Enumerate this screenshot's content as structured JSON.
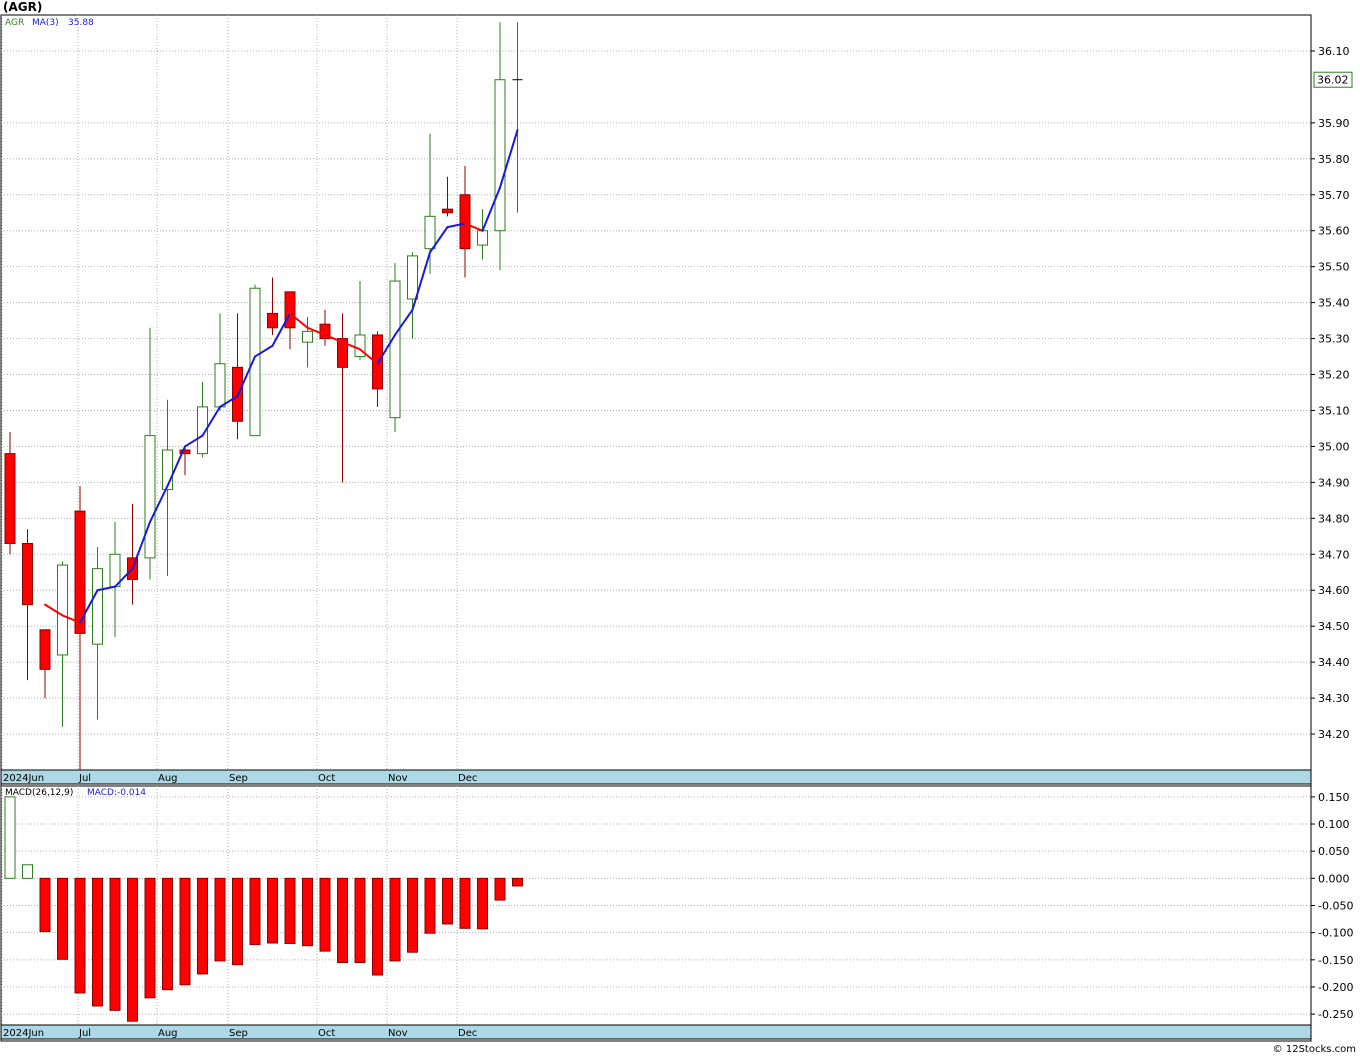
{
  "title": "(AGR)",
  "credit": "© 12Stocks.com",
  "colors": {
    "up": "#2e7d1e",
    "down": "#ff0000",
    "ma": "#1a1adb",
    "axis_band": "#add8e6",
    "grid": "#b0b0b0",
    "last_label": "#2e7d1e"
  },
  "chart_data": [
    {
      "type": "candlestick",
      "legend": {
        "symbol": "AGR",
        "ma_label": "MA(3)",
        "ma_value": "35.88"
      },
      "last_price_label": "36.02",
      "ylim": [
        34.1,
        36.2
      ],
      "yticks": [
        "34.20",
        "34.30",
        "34.40",
        "34.50",
        "34.60",
        "34.70",
        "34.80",
        "34.90",
        "35.00",
        "35.10",
        "35.20",
        "35.30",
        "35.40",
        "35.50",
        "35.60",
        "35.70",
        "35.80",
        "35.90",
        "36.10"
      ],
      "ytick_values": [
        34.2,
        34.3,
        34.4,
        34.5,
        34.6,
        34.7,
        34.8,
        34.9,
        35.0,
        35.1,
        35.2,
        35.3,
        35.4,
        35.5,
        35.6,
        35.7,
        35.8,
        35.9,
        36.1
      ],
      "xlabels": [
        "2024Jun",
        "Jul",
        "Aug",
        "Sep",
        "Oct",
        "Nov",
        "Dec"
      ],
      "x_label_index": [
        0,
        4,
        9,
        13,
        18,
        22,
        26
      ],
      "candles": [
        {
          "o": 34.98,
          "h": 35.04,
          "l": 34.7,
          "c": 34.73,
          "ma": null
        },
        {
          "o": 34.73,
          "h": 34.77,
          "l": 34.35,
          "c": 34.56,
          "ma": null
        },
        {
          "o": 34.49,
          "h": 34.49,
          "l": 34.3,
          "c": 34.38,
          "ma": 34.56
        },
        {
          "o": 34.42,
          "h": 34.68,
          "l": 34.22,
          "c": 34.67,
          "ma": 34.53
        },
        {
          "o": 34.82,
          "h": 34.89,
          "l": 34.1,
          "c": 34.48,
          "ma": 34.51
        },
        {
          "o": 34.45,
          "h": 34.72,
          "l": 34.24,
          "c": 34.66,
          "ma": 34.6
        },
        {
          "o": 34.61,
          "h": 34.79,
          "l": 34.47,
          "c": 34.7,
          "ma": 34.61
        },
        {
          "o": 34.69,
          "h": 34.84,
          "l": 34.56,
          "c": 34.63,
          "ma": 34.66
        },
        {
          "o": 34.69,
          "h": 35.33,
          "l": 34.63,
          "c": 35.03,
          "ma": 34.79
        },
        {
          "o": 34.88,
          "h": 35.13,
          "l": 34.64,
          "c": 34.99,
          "ma": 34.89
        },
        {
          "o": 34.99,
          "h": 35.0,
          "l": 34.92,
          "c": 34.98,
          "ma": 35.0
        },
        {
          "o": 34.98,
          "h": 35.18,
          "l": 34.97,
          "c": 35.11,
          "ma": 35.03
        },
        {
          "o": 35.11,
          "h": 35.37,
          "l": 35.1,
          "c": 35.23,
          "ma": 35.11
        },
        {
          "o": 35.22,
          "h": 35.37,
          "l": 35.02,
          "c": 35.07,
          "ma": 35.14
        },
        {
          "o": 35.03,
          "h": 35.45,
          "l": 35.03,
          "c": 35.44,
          "ma": 35.25
        },
        {
          "o": 35.37,
          "h": 35.47,
          "l": 35.31,
          "c": 35.33,
          "ma": 35.28
        },
        {
          "o": 35.43,
          "h": 35.43,
          "l": 35.27,
          "c": 35.33,
          "ma": 35.37
        },
        {
          "o": 35.29,
          "h": 35.36,
          "l": 35.22,
          "c": 35.32,
          "ma": 35.33
        },
        {
          "o": 35.34,
          "h": 35.38,
          "l": 35.28,
          "c": 35.3,
          "ma": 35.31
        },
        {
          "o": 35.3,
          "h": 35.37,
          "l": 34.9,
          "c": 35.22,
          "ma": 35.29
        },
        {
          "o": 35.25,
          "h": 35.46,
          "l": 35.24,
          "c": 35.31,
          "ma": 35.27
        },
        {
          "o": 35.31,
          "h": 35.32,
          "l": 35.11,
          "c": 35.16,
          "ma": 35.23
        },
        {
          "o": 35.08,
          "h": 35.51,
          "l": 35.04,
          "c": 35.46,
          "ma": 35.31
        },
        {
          "o": 35.41,
          "h": 35.54,
          "l": 35.3,
          "c": 35.53,
          "ma": 35.38
        },
        {
          "o": 35.55,
          "h": 35.87,
          "l": 35.48,
          "c": 35.64,
          "ma": 35.54
        },
        {
          "o": 35.66,
          "h": 35.75,
          "l": 35.64,
          "c": 35.65,
          "ma": 35.61
        },
        {
          "o": 35.7,
          "h": 35.78,
          "l": 35.47,
          "c": 35.55,
          "ma": 35.62
        },
        {
          "o": 35.56,
          "h": 35.66,
          "l": 35.52,
          "c": 35.6,
          "ma": 35.6
        },
        {
          "o": 35.6,
          "h": 36.18,
          "l": 35.49,
          "c": 36.02,
          "ma": 35.72
        },
        {
          "o": 36.02,
          "h": 36.18,
          "l": 35.65,
          "c": 36.02,
          "ma": 35.88
        }
      ]
    },
    {
      "type": "bar",
      "legend": {
        "label": "MACD(26,12,9)",
        "value_label": "MACD:-0.014"
      },
      "ylim": [
        -0.27,
        0.17
      ],
      "yticks": [
        "0.150",
        "0.100",
        "0.050",
        "0.000",
        "-0.050",
        "-0.100",
        "-0.150",
        "-0.200",
        "-0.250"
      ],
      "ytick_values": [
        0.15,
        0.1,
        0.05,
        0.0,
        -0.05,
        -0.1,
        -0.15,
        -0.2,
        -0.25
      ],
      "xlabels": [
        "2024Jun",
        "Jul",
        "Aug",
        "Sep",
        "Oct",
        "Nov",
        "Dec"
      ],
      "x_label_index": [
        0,
        4,
        9,
        13,
        18,
        22,
        26
      ],
      "values": [
        0.15,
        0.025,
        -0.098,
        -0.149,
        -0.211,
        -0.235,
        -0.243,
        -0.263,
        -0.22,
        -0.205,
        -0.196,
        -0.176,
        -0.152,
        -0.159,
        -0.122,
        -0.119,
        -0.12,
        -0.124,
        -0.134,
        -0.155,
        -0.155,
        -0.178,
        -0.152,
        -0.136,
        -0.101,
        -0.084,
        -0.092,
        -0.093,
        -0.04,
        -0.014
      ]
    }
  ]
}
